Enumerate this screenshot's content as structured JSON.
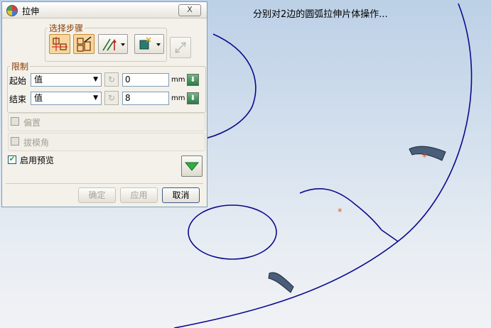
{
  "caption": "分别对2边的圆弧拉伸片体操作...",
  "dialog": {
    "title": "拉伸",
    "close_label": "X",
    "steps_group_label": "选择步骤",
    "limits_group_label": "限制",
    "start": {
      "label": "起始",
      "type_value": "值",
      "amount": "0",
      "unit": "mm"
    },
    "end": {
      "label": "结束",
      "type_value": "值",
      "amount": "8",
      "unit": "mm"
    },
    "offset_label": "偏置",
    "draft_label": "拔模角",
    "preview_label": "启用预览",
    "preview_checked": true,
    "buttons": {
      "ok": "确定",
      "apply": "应用",
      "cancel": "取消"
    }
  },
  "colors": {
    "curve": "#0b0a8c",
    "marker": "#e05a1a",
    "sheet": "#4a5e7a",
    "legend": "#8a3a00"
  },
  "markers": [
    "*",
    "*"
  ]
}
